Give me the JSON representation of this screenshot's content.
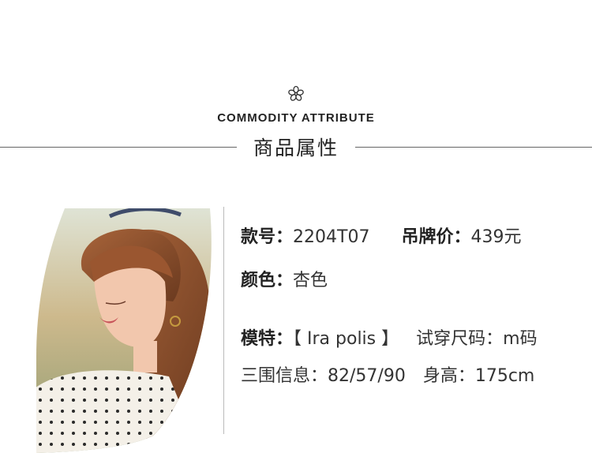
{
  "header": {
    "en_title": "COMMODITY ATTRIBUTE",
    "cn_title": "商品属性"
  },
  "attributes": {
    "style_label": "款号：",
    "style_value": "2204T07",
    "price_label": "吊牌价：",
    "price_value": "439元",
    "color_label": "颜色：",
    "color_value": "杏色",
    "model_label": "模特：",
    "model_value": "【 Ira polis 】",
    "size_label": "试穿尺码：",
    "size_value": "m码",
    "measure_label": "三围信息：",
    "measure_value": "82/57/90",
    "height_label": "身高：",
    "height_value": "175cm"
  },
  "colors": {
    "text": "#333333",
    "rule": "#666666"
  }
}
